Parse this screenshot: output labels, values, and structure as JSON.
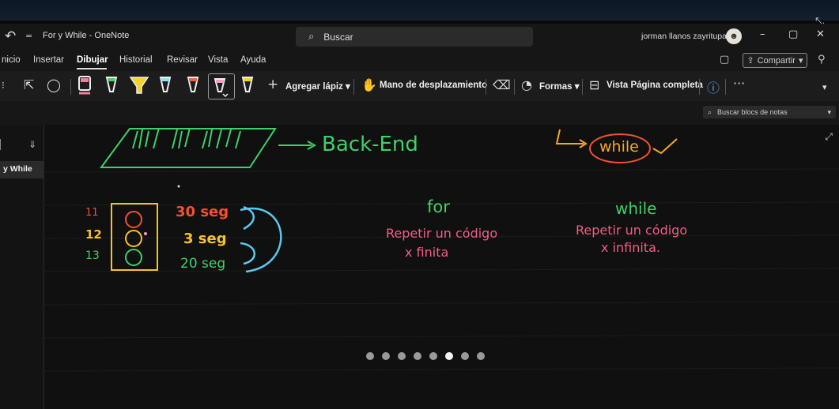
{
  "window": {
    "title": "For y While - OneNote",
    "search_placeholder": "Buscar",
    "user": "jorman llanos zayritupac"
  },
  "menu": {
    "items": [
      "nicio",
      "Insertar",
      "Dibujar",
      "Historial",
      "Revisar",
      "Vista",
      "Ayuda"
    ],
    "active": "Dibujar",
    "share_label": "Compartir"
  },
  "ribbon": {
    "add_pencil": "Agregar lápiz",
    "pan_tool": "Mano de desplazamiento",
    "shapes": "Formas",
    "full_page_view": "Vista Página completa",
    "more": "···",
    "pens": [
      {
        "color": "#f47c9a"
      },
      {
        "color": "#4ad071"
      },
      {
        "color": "#f4d330"
      },
      {
        "color": "#7fe8f4"
      },
      {
        "color": "#f5603d"
      },
      {
        "color": "#f49cc0"
      },
      {
        "color": "#f4d330"
      }
    ]
  },
  "subbar": {
    "notes_search": "Buscar blocs de notas"
  },
  "sidebar": {
    "page": "y While"
  },
  "note": {
    "backend": "Back-End",
    "while_circled": "while",
    "row_numbers": [
      "11",
      "12",
      "13"
    ],
    "times": [
      "30 seg",
      "3 seg",
      "20 seg"
    ],
    "for_heading": "for",
    "for_line1": "Repetir un código",
    "for_line2": "x finita",
    "while_heading": "while",
    "while_line1": "Repetir un código",
    "while_line2": "x infinita.",
    "colors": {
      "green": "#3ed06a",
      "orange": "#f7a823",
      "red": "#f4502f",
      "pink": "#f45c86",
      "cyan": "#5bc8f0",
      "yellow": "#f5c424"
    }
  },
  "carousel": {
    "dot_count": 8,
    "active_index": 5
  }
}
